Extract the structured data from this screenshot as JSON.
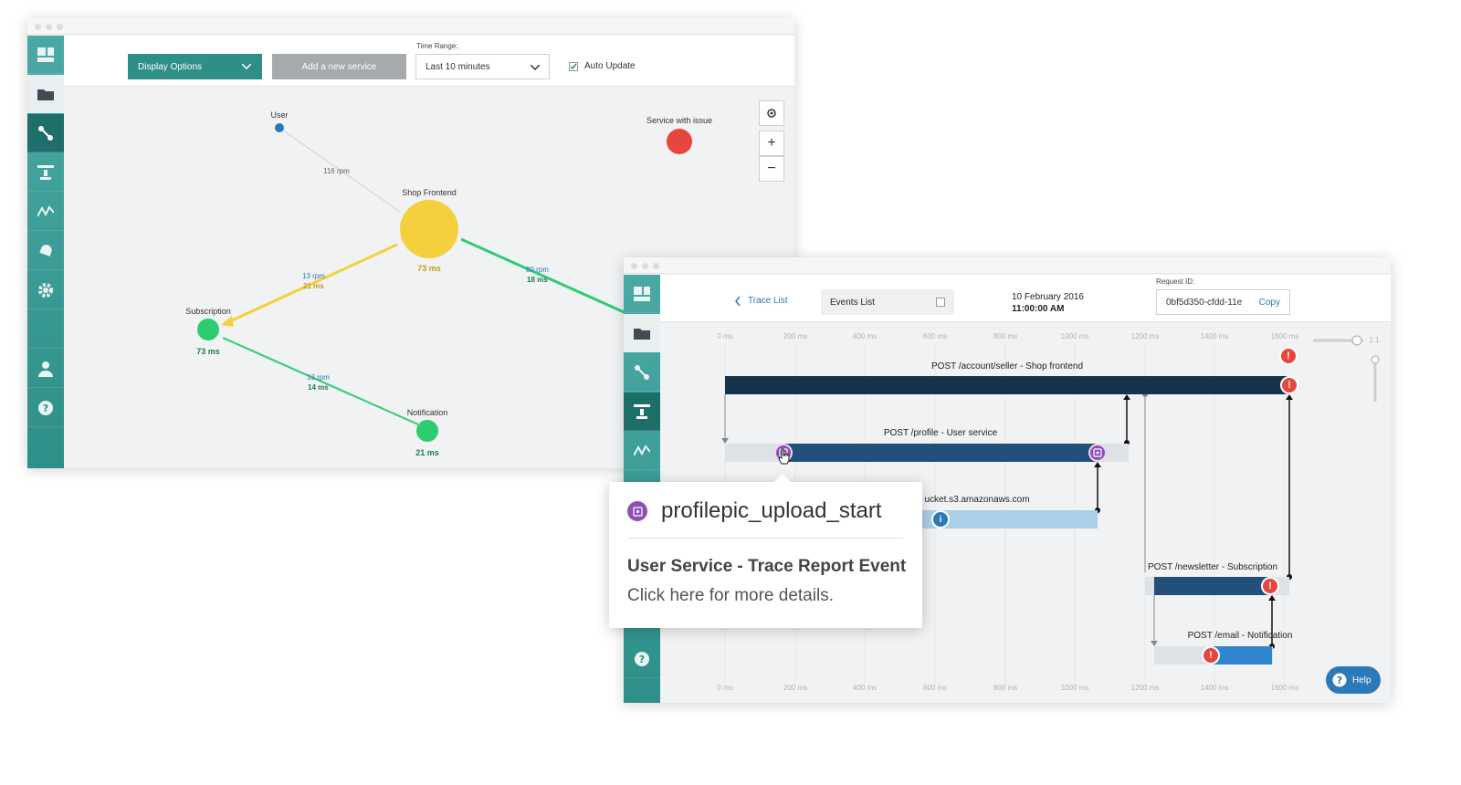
{
  "service_map": {
    "toolbar": {
      "display_options": "Display Options",
      "add_service": "Add a new service",
      "time_range_label": "Time Range:",
      "time_range_value": "Last 10 minutes",
      "auto_update_label": "Auto Update"
    },
    "legend_issue": "Service with issue",
    "nodes": {
      "user": "User",
      "shop_frontend": "Shop Frontend",
      "shop_frontend_latency": "73 ms",
      "subscription": "Subscription",
      "subscription_latency": "73 ms",
      "notification": "Notification",
      "notification_latency": "21 ms"
    },
    "edges": {
      "user_shop_rpm": "116 rpm",
      "shop_sub_rpm": "13 rpm",
      "shop_sub_ms": "21 ms",
      "shop_right_rpm": "80 rpm",
      "shop_right_ms": "18 ms",
      "sub_notif_rpm": "13 rpm",
      "sub_notif_ms": "14 ms"
    },
    "zoom": {
      "plus": "+",
      "minus": "−"
    }
  },
  "trace": {
    "header": {
      "back_label": "Trace List",
      "events_list": "Events List",
      "date": "10 February 2016",
      "time": "11:00:00 AM",
      "request_id_label": "Request ID:",
      "request_id_value": "0bf5d350-cfdd-11e",
      "copy_label": "Copy"
    },
    "axis_ticks": [
      "0 ms",
      "200 ms",
      "400 ms",
      "600 ms",
      "800 ms",
      "1000 ms",
      "1200 ms",
      "1400 ms",
      "1600 ms"
    ],
    "zoom_label": "1:1",
    "spans": {
      "account": "POST /account/seller - Shop frontend",
      "profile": "POST /profile - User service",
      "s3": "ucket.s3.amazonaws.com",
      "newsletter": "POST /newsletter - Subscription",
      "email": "POST /email - Notification"
    },
    "error_glyph": "!",
    "info_glyph": "i",
    "help_label": "Help"
  },
  "tooltip": {
    "event_name": "profilepic_upload_start",
    "title": "User Service - Trace Report Event",
    "subtitle": "Click here for more details."
  },
  "colors": {
    "teal": "#2e8f89",
    "green_button": "#2e8f89",
    "yellow": "#f4d03f",
    "green_node": "#2ecc71",
    "red": "#e8453c",
    "navy": "#17324d",
    "blue": "#2b79b7",
    "purple": "#8e4fb5"
  }
}
